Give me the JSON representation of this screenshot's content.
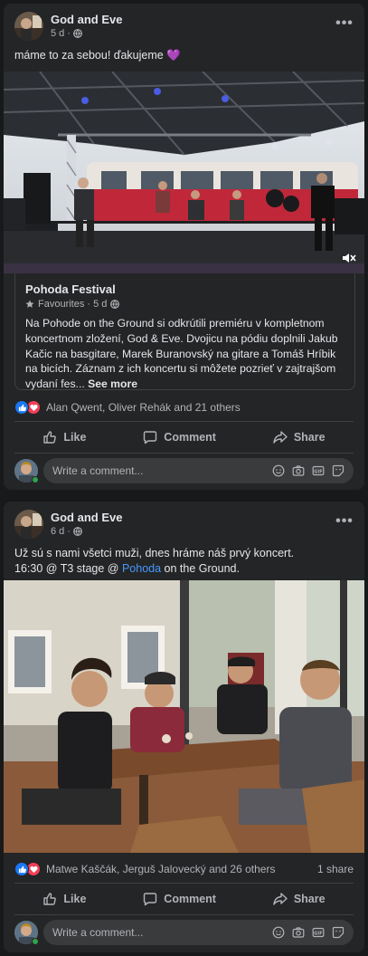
{
  "posts": [
    {
      "author": "God and Eve",
      "time": "5 d",
      "text": "máme to za sebou! ďakujeme 💜",
      "link_card": {
        "title": "Pohoda Festival",
        "subtitle": "Favourites · 5 d",
        "body": "Na Pohode on the Ground si odkrútili premiéru v kompletnom koncertnom zložení, God & Eve. Dvojicu na pódiu doplnili Jakub Kačic na basgitare, Marek Buranovský na gitare a Tomáš Hríbik na bicích. Záznam z ich koncertu si môžete pozrieť v zajtrajšom vydaní fes...",
        "see_more": "See more"
      },
      "reactions": "Alan Qwent, Oliver Rehák and 21 others",
      "shares": "",
      "actions": {
        "like": "Like",
        "comment": "Comment",
        "share": "Share"
      },
      "comment_placeholder": "Write a comment..."
    },
    {
      "author": "God and Eve",
      "time": "6 d",
      "text_line1": "Už sú s nami všetci muži, dnes hráme náš prvý koncert.",
      "text_line2_before": "16:30 @ T3 stage @ ",
      "text_line2_link": "Pohoda",
      "text_line2_after": " on the Ground.",
      "reactions": "Matwe Kaščák, Jerguš Jalovecký and 26 others",
      "shares": "1 share",
      "actions": {
        "like": "Like",
        "comment": "Comment",
        "share": "Share"
      },
      "comment_placeholder": "Write a comment..."
    }
  ],
  "colors": {
    "background": "#18191a",
    "card": "#242526",
    "link": "#4599ff",
    "like_blue": "#1877f2",
    "love_red": "#f33e58",
    "online_green": "#31a24c"
  },
  "icons": [
    "globe-icon",
    "more-icon",
    "like-icon",
    "comment-icon",
    "share-icon",
    "emoji-icon",
    "camera-icon",
    "gif-icon",
    "sticker-icon",
    "mute-icon",
    "star-icon"
  ]
}
